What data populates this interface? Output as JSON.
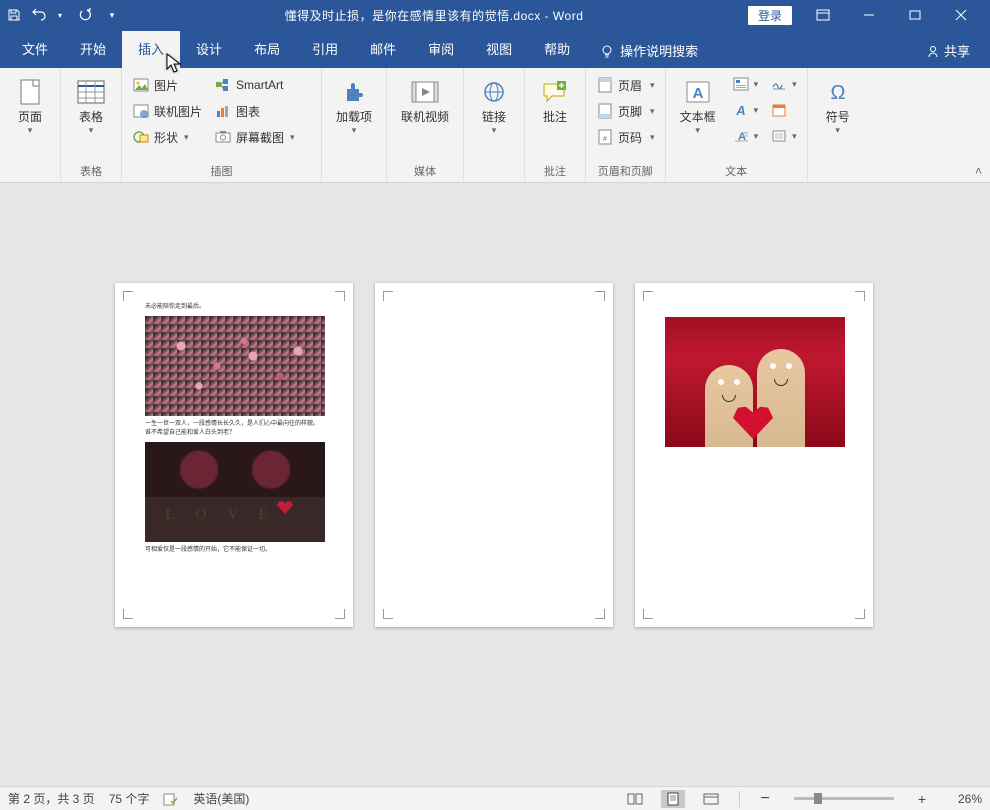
{
  "titlebar": {
    "doc_title": "懂得及时止损，是你在感情里该有的觉悟.docx - Word",
    "login": "登录"
  },
  "tabs": {
    "file": "文件",
    "home": "开始",
    "insert": "插入",
    "design": "设计",
    "layout": "布局",
    "references": "引用",
    "mail": "邮件",
    "review": "审阅",
    "view": "视图",
    "help": "帮助",
    "tell_me": "操作说明搜索",
    "share": "共享"
  },
  "ribbon": {
    "pages": {
      "label": "页面",
      "group": ""
    },
    "tables": {
      "label": "表格",
      "group": "表格"
    },
    "illustrations": {
      "picture": "图片",
      "online_picture": "联机图片",
      "shapes": "形状",
      "smartart": "SmartArt",
      "chart": "图表",
      "screenshot": "屏幕截图",
      "group": "插图"
    },
    "addins": {
      "label": "加载项",
      "group": ""
    },
    "media": {
      "label": "联机视频",
      "group": "媒体"
    },
    "links": {
      "label": "链接",
      "group": ""
    },
    "comments": {
      "label": "批注",
      "group": "批注"
    },
    "header_footer": {
      "header": "页眉",
      "footer": "页脚",
      "page_number": "页码",
      "group": "页眉和页脚"
    },
    "text": {
      "label": "文本框",
      "group": "文本"
    },
    "symbols": {
      "label": "符号",
      "group": ""
    }
  },
  "document": {
    "page1": {
      "line1": "未必能陪你走到最后。",
      "line2": "一生一世一双人，一段感情长长久久，是人们心中最向往的样貌。谁不希望自己能和爱人白头到老？",
      "line3": "可相爱仅是一段感情的开始，它不能保证一切。"
    }
  },
  "statusbar": {
    "page_info": "第 2 页，共 3 页",
    "word_count": "75 个字",
    "language": "英语(美国)",
    "zoom_minus": "−",
    "zoom_plus": "+",
    "zoom": "26%"
  }
}
